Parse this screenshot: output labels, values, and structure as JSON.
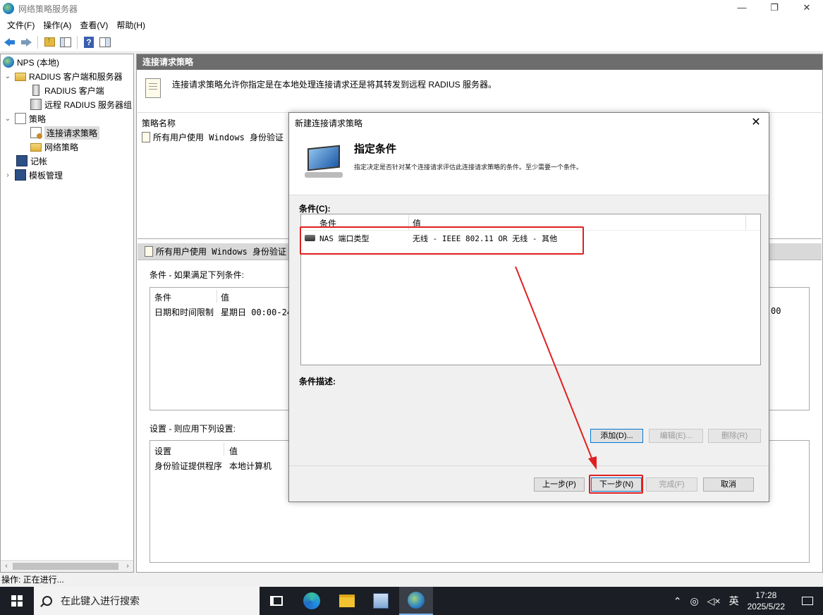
{
  "window": {
    "title": "网络策略服务器",
    "controls": [
      "—",
      "❐",
      "✕"
    ]
  },
  "menu": [
    "文件(F)",
    "操作(A)",
    "查看(V)",
    "帮助(H)"
  ],
  "tree": {
    "items": [
      {
        "label": "NPS (本地)",
        "icon": "globe-icon",
        "expander": ""
      },
      {
        "label": "RADIUS 客户端和服务器",
        "icon": "folder-icon",
        "expander": "⌄"
      },
      {
        "label": "RADIUS 客户端",
        "icon": "server-icon",
        "expander": ""
      },
      {
        "label": "远程 RADIUS 服务器组",
        "icon": "server-group-icon",
        "expander": ""
      },
      {
        "label": "策略",
        "icon": "policy-doc-icon",
        "expander": "⌄"
      },
      {
        "label": "连接请求策略",
        "icon": "connection-policy-icon",
        "expander": "",
        "selected": true
      },
      {
        "label": "网络策略",
        "icon": "folder-icon",
        "expander": ""
      },
      {
        "label": "记帐",
        "icon": "accounting-icon",
        "expander": ""
      },
      {
        "label": "模板管理",
        "icon": "template-icon",
        "expander": "›"
      }
    ]
  },
  "right": {
    "header": "连接请求策略",
    "info": "连接请求策略允许你指定是在本地处理连接请求还是将其转发到远程 RADIUS 服务器。",
    "list_header": "策略名称",
    "policy_name": "所有用户使用 Windows 身份验证",
    "detail_title": "所有用户使用 Windows 身份验证",
    "conditions_label": "条件 - 如果满足下列条件:",
    "conditions_table": {
      "headers": [
        "条件",
        "值"
      ],
      "row": [
        "日期和时间限制",
        "星期日 00:00-24:0",
        "00"
      ]
    },
    "settings_label": "设置 - 则应用下列设置:",
    "settings_table": {
      "headers": [
        "设置",
        "值"
      ],
      "row": [
        "身份验证提供程序",
        "本地计算机"
      ]
    }
  },
  "status": "操作: 正在进行...",
  "dialog": {
    "title": "新建连接请求策略",
    "close": "✕",
    "heading": "指定条件",
    "subheading": "指定决定是否针对某个连接请求评估此连接请求策略的条件。至少需要一个条件。",
    "conditions_label": "条件(C):",
    "list_headers": [
      "条件",
      "值"
    ],
    "list_row": {
      "condition": "NAS 端口类型",
      "value": "无线 - IEEE 802.11 OR 无线 - 其他"
    },
    "desc_label": "条件描述:",
    "buttons": {
      "add": "添加(D)...",
      "edit": "编辑(E)...",
      "remove": "删除(R)",
      "prev": "上一步(P)",
      "next": "下一步(N)",
      "finish": "完成(F)",
      "cancel": "取消"
    },
    "annotation_color": "#e02020"
  },
  "taskbar": {
    "search_placeholder": "在此键入进行搜索",
    "ime": "英",
    "time": "17:28",
    "date": "2025/5/22"
  }
}
